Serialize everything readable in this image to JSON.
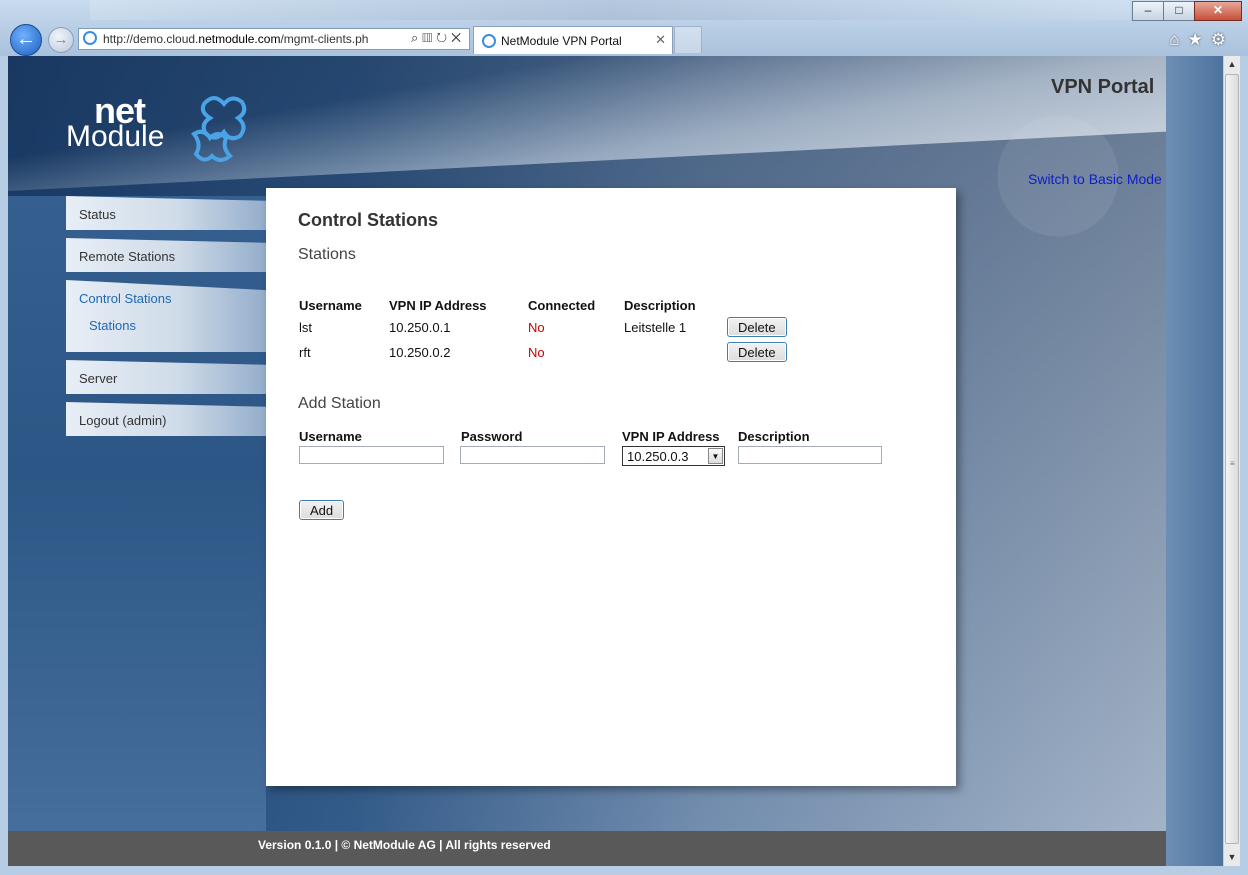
{
  "browser": {
    "url_prefix": "http://demo.cloud.",
    "url_domain": "netmodule.com",
    "url_path": "/mgmt-clients.ph",
    "tab_title": "NetModule VPN Portal",
    "window_buttons": {
      "minimize": "–",
      "maximize": "□",
      "close": "✕"
    }
  },
  "header": {
    "logo_net": "net",
    "logo_module": "Module",
    "title": "VPN Portal",
    "mode_link": "Switch to Basic Mode"
  },
  "menu": {
    "items": [
      {
        "label": "Status"
      },
      {
        "label": "Remote Stations"
      },
      {
        "label": "Control Stations",
        "sub": "Stations"
      },
      {
        "label": "Server"
      },
      {
        "label": "Logout (admin)"
      }
    ]
  },
  "main": {
    "title": "Control Stations",
    "stations_heading": "Stations",
    "columns": [
      "Username",
      "VPN IP Address",
      "Connected",
      "Description"
    ],
    "rows": [
      {
        "username": "lst",
        "ip": "10.250.0.1",
        "connected": "No",
        "description": "Leitstelle 1",
        "action": "Delete"
      },
      {
        "username": "rft",
        "ip": "10.250.0.2",
        "connected": "No",
        "description": "",
        "action": "Delete"
      }
    ],
    "add_heading": "Add Station",
    "form": {
      "username_label": "Username",
      "password_label": "Password",
      "ip_label": "VPN IP Address",
      "description_label": "Description",
      "ip_selected": "10.250.0.3",
      "add_label": "Add"
    }
  },
  "footer": {
    "text": "Version 0.1.0 | © NetModule AG | All rights reserved"
  },
  "colors": {
    "link": "#0c1ccf",
    "active_menu": "#2168b3",
    "status_no": "#cc0000",
    "footer_bg": "#595959"
  }
}
